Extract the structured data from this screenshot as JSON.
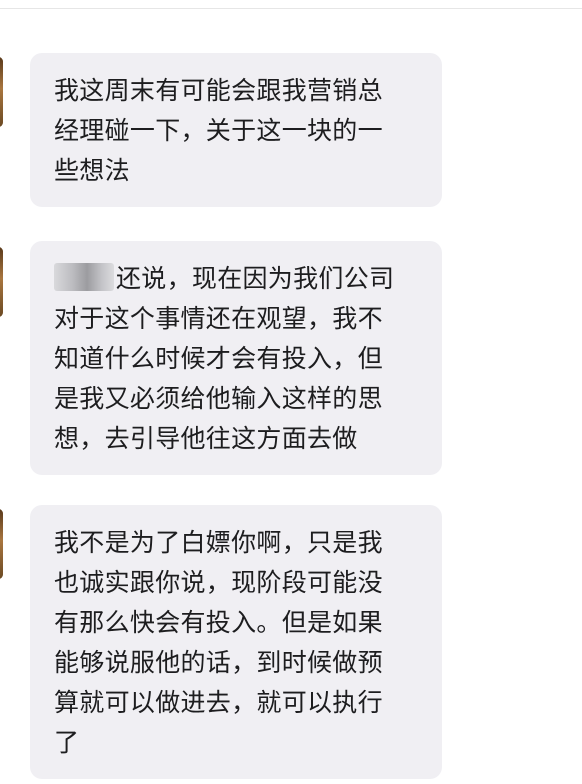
{
  "messages": [
    {
      "lines": [
        "我这周末有可能会跟我营销总",
        "经理碰一下，关于这一块的一",
        "些想法"
      ]
    },
    {
      "redacted_prefix": true,
      "first_line_rest": "还说，现在因为我们公司",
      "lines": [
        "对于这个事情还在观望，我不",
        "知道什么时候才会有投入，但",
        "是我又必须给他输入这样的思",
        "想，去引导他往这方面去做"
      ]
    },
    {
      "lines": [
        "我不是为了白嫖你啊，只是我",
        "也诚实跟你说，现阶段可能没",
        "有那么快会有投入。但是如果",
        "能够说服他的话，到时候做预",
        "算就可以做进去，就可以执行",
        "了"
      ]
    }
  ],
  "colors": {
    "bubble_bg": "#f0eff3",
    "text": "#1d1d1f",
    "background": "#ffffff"
  }
}
